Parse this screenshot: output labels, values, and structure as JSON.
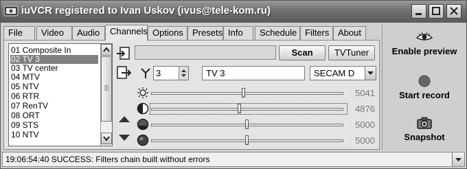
{
  "window": {
    "title": "iuVCR registered to Ivan Uskov (ivus@tele-kom.ru)"
  },
  "tabs": [
    {
      "label": "File"
    },
    {
      "label": "Video"
    },
    {
      "label": "Audio"
    },
    {
      "label": "Channels"
    },
    {
      "label": "Options"
    },
    {
      "label": "Presets"
    },
    {
      "label": "Info"
    },
    {
      "label": "Schedule"
    },
    {
      "label": "Filters"
    },
    {
      "label": "About"
    }
  ],
  "active_tab": "Channels",
  "channels": [
    "01 Composite In",
    "02 TV 3",
    "03 TV center",
    "04 MTV",
    "05 NTV",
    "06 RTR",
    "07 RenTV",
    "08 ORT",
    "09 STS",
    "10 NTV"
  ],
  "selected_channel": "02 TV 3",
  "tuner": {
    "scan_label": "Scan",
    "tvtuner_label": "TVTuner",
    "channel_number": "3",
    "channel_name": "TV 3",
    "standard": "SECAM D"
  },
  "sliders": [
    {
      "name": "brightness",
      "value": "5041",
      "level": 0.48
    },
    {
      "name": "contrast",
      "value": "4876",
      "level": 0.46
    },
    {
      "name": "saturation",
      "value": "5000",
      "level": 0.5
    },
    {
      "name": "hue",
      "value": "5000",
      "level": 0.5
    }
  ],
  "right_panel": {
    "preview_label": "Enable preview",
    "record_label": "Start record",
    "snapshot_label": "Snapshot"
  },
  "status": {
    "text": "19:06:54:40 SUCCESS: Filters chain built without errors"
  }
}
